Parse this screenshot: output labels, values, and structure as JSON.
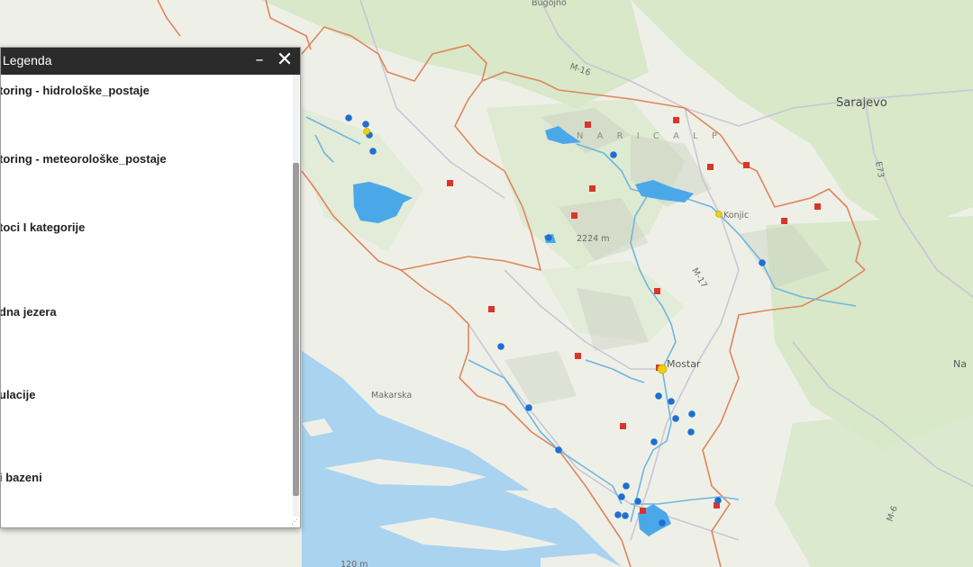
{
  "legend": {
    "title": "Legenda",
    "minimize_glyph": "–",
    "close_glyph": "✕",
    "items": [
      {
        "label": "toring - hidrološke_postaje"
      },
      {
        "label": "toring - meteorološke_postaje"
      },
      {
        "label": "toci I kategorije"
      },
      {
        "label": "dna jezera"
      },
      {
        "label": "ulacije"
      },
      {
        "label": "i bazeni"
      }
    ]
  },
  "map": {
    "places": [
      {
        "label": "Sarajevo"
      },
      {
        "label": "Bugojno"
      },
      {
        "label": "Konjic"
      },
      {
        "label": "Mostar"
      },
      {
        "label": "Makarska"
      },
      {
        "label": "2224 m"
      },
      {
        "label": "N A R I C   A L P"
      },
      {
        "label": "Na"
      },
      {
        "label": "M-16"
      },
      {
        "label": "M-17"
      },
      {
        "label": "E73"
      },
      {
        "label": "M-6"
      },
      {
        "label": "120 m"
      }
    ],
    "colors": {
      "land": "#eef0e8",
      "forest": "#d4e6c6",
      "sea": "#a9d3ef",
      "border": "#e08a5c",
      "river": "#6fb6df",
      "lake": "#4ba8e8",
      "station_blue": "#1f6fd1",
      "station_red": "#d9352b",
      "station_yellow": "#f0d000"
    }
  }
}
